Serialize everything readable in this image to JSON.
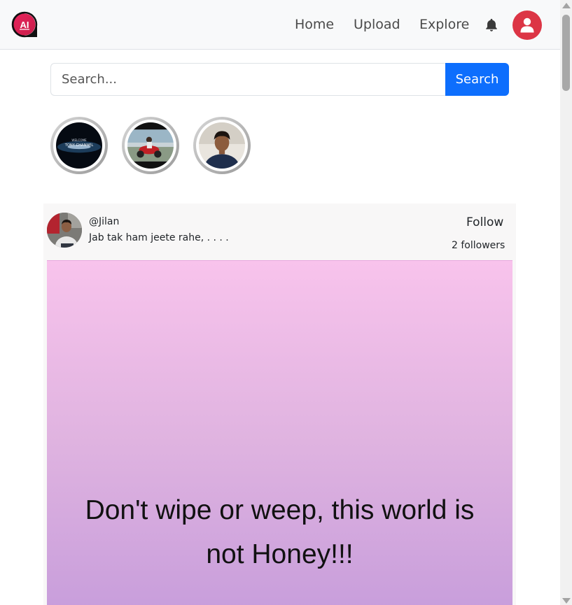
{
  "navbar": {
    "logo_text": "AI",
    "links": [
      {
        "label": "Home"
      },
      {
        "label": "Upload"
      },
      {
        "label": "Explore"
      }
    ]
  },
  "search": {
    "placeholder": "Search...",
    "button_label": "Search"
  },
  "stories": [
    {
      "caption": "WELCOME"
    },
    {
      "caption": ""
    },
    {
      "caption": ""
    }
  ],
  "story_banner": {
    "line2": "TONY CHANNEL"
  },
  "post": {
    "username": "@Jilan",
    "bio": "Jab tak ham jeete rahe, . . . .",
    "follow_label": "Follow",
    "followers_text": "2 followers",
    "image_text_line1": "Don't wipe or weep, this world is",
    "image_text_line2": "not Honey!!!"
  },
  "colors": {
    "accent_blue": "#0d6efd",
    "avatar_red": "#dc3545",
    "navbar_bg": "#f8f9fa"
  }
}
